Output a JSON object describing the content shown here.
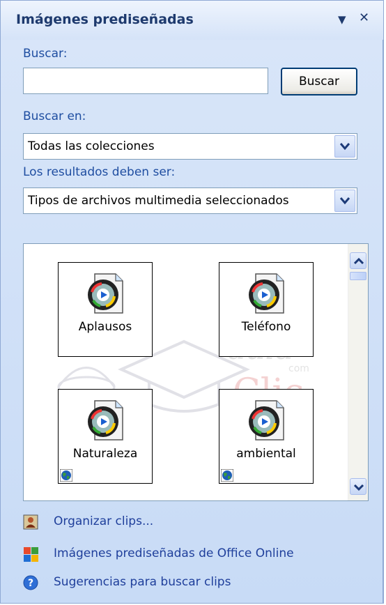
{
  "pane": {
    "title": "Imágenes prediseñadas",
    "menu_glyph": "▼",
    "close_glyph": "✕"
  },
  "search": {
    "label": "Buscar:",
    "input_value": "",
    "button_label": "Buscar"
  },
  "search_in": {
    "label": "Buscar en:",
    "selected": "Todas las colecciones"
  },
  "results_type": {
    "label": "Los resultados deben ser:",
    "selected": "Tipos de archivos multimedia seleccionados"
  },
  "clips": [
    {
      "label": "Aplausos",
      "icon": "media-clip-icon",
      "online": false
    },
    {
      "label": "Teléfono",
      "icon": "media-clip-icon",
      "online": false
    },
    {
      "label": "Naturaleza",
      "icon": "media-clip-icon",
      "online": true
    },
    {
      "label": "ambiental",
      "icon": "media-clip-icon",
      "online": true
    }
  ],
  "watermark": {
    "line1": "aula",
    "line2": "com",
    "line3": "Clic"
  },
  "links": [
    {
      "label": "Organizar clips...",
      "icon": "organize-clips-icon"
    },
    {
      "label": "Imágenes prediseñadas de Office Online",
      "icon": "office-online-icon"
    },
    {
      "label": "Sugerencias para buscar clips",
      "icon": "help-icon"
    }
  ],
  "colors": {
    "pane_bg": "#c8dbf6",
    "title_text": "#1e3a6e",
    "label_text": "#1f4ea1",
    "link_text": "#1f3f9b",
    "button_border": "#003c74"
  }
}
